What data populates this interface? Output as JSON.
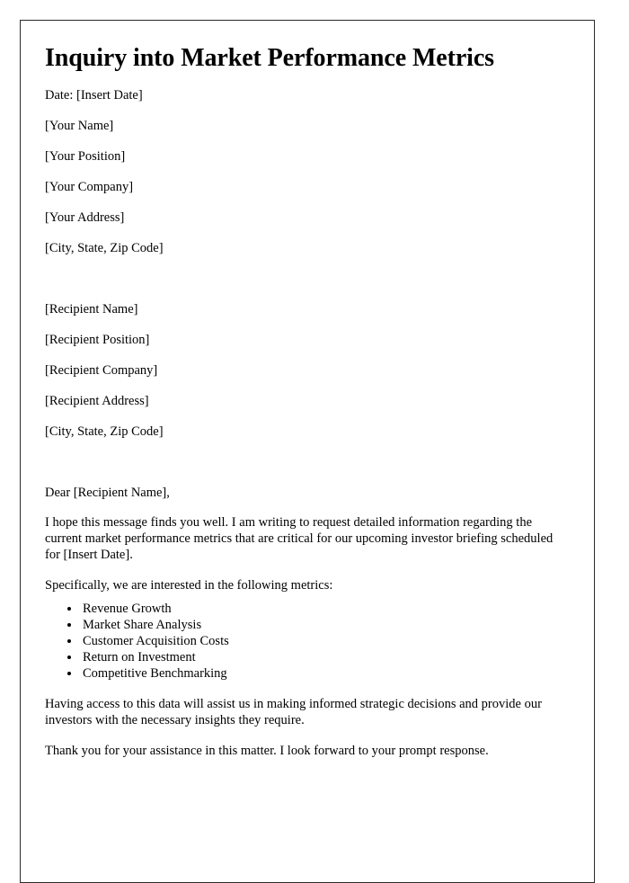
{
  "document": {
    "title": "Inquiry into Market Performance Metrics",
    "date_line": "Date: [Insert Date]",
    "sender_block": [
      "[Your Name]",
      "[Your Position]",
      "[Your Company]",
      "[Your Address]",
      "[City, State, Zip Code]"
    ],
    "recipient_block": [
      "[Recipient Name]",
      "[Recipient Position]",
      "[Recipient Company]",
      "[Recipient Address]",
      "[City, State, Zip Code]"
    ],
    "salutation": "Dear [Recipient Name],",
    "paragraph_intro": "I hope this message finds you well. I am writing to request detailed information regarding the current market performance metrics that are critical for our upcoming investor briefing scheduled for [Insert Date].",
    "paragraph_list_lead": "Specifically, we are interested in the following metrics:",
    "metrics": [
      "Revenue Growth",
      "Market Share Analysis",
      "Customer Acquisition Costs",
      "Return on Investment",
      "Competitive Benchmarking"
    ],
    "paragraph_benefit": "Having access to this data will assist us in making informed strategic decisions and provide our investors with the necessary insights they require.",
    "paragraph_thanks": "Thank you for your assistance in this matter. I look forward to your prompt response."
  }
}
